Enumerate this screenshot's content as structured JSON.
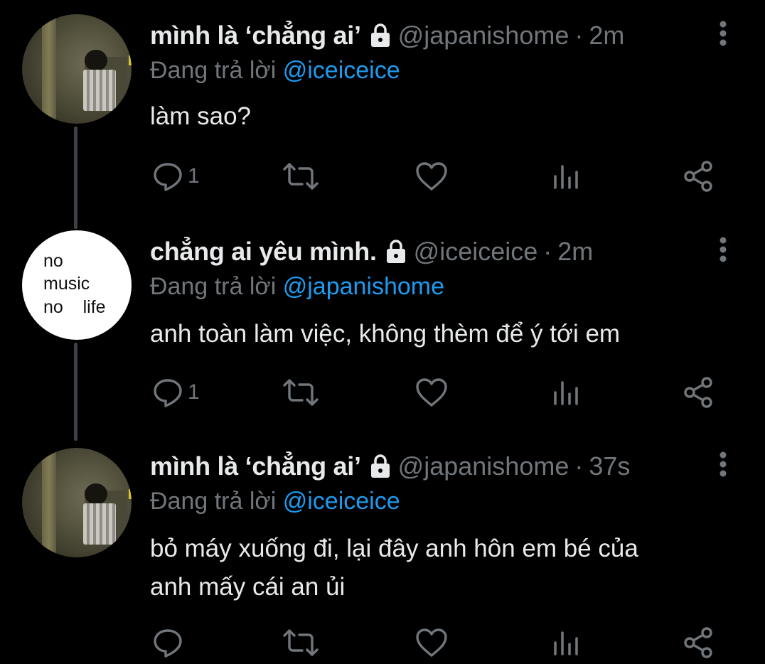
{
  "colors": {
    "background": "#000000",
    "primary_text": "#e7e9ea",
    "secondary_text": "#71767b",
    "accent": "#1d9bf0",
    "thread_line": "#3d4146"
  },
  "icons": {
    "lock": "lock-icon",
    "more": "more-vertical-icon",
    "reply": "reply-bubble-icon",
    "retweet": "retweet-icon",
    "like": "heart-icon",
    "views": "bar-chart-icon",
    "share": "share-icon"
  },
  "tweets": [
    {
      "display_name": "mình là ‘chẳng ai’",
      "handle": "@japanishome",
      "separator": "·",
      "time": "2m",
      "reply_prefix": "Đang trả lời",
      "reply_to": "@iceiceice",
      "text_lines": [
        "làm sao?"
      ],
      "reply_count": "1",
      "avatar_type": "photo"
    },
    {
      "display_name": "chẳng ai yêu mình.",
      "handle": "@iceiceice",
      "separator": "·",
      "time": "2m",
      "reply_prefix": "Đang trả lời",
      "reply_to": "@japanishome",
      "text_lines": [
        "anh toàn làm việc, không thèm để ý tới em"
      ],
      "reply_count": "1",
      "avatar_type": "text",
      "avatar_lines": [
        "no",
        "music",
        "no    life"
      ]
    },
    {
      "display_name": "mình là ‘chẳng ai’",
      "handle": "@japanishome",
      "separator": "·",
      "time": "37s",
      "reply_prefix": "Đang trả lời",
      "reply_to": "@iceiceice",
      "text_lines": [
        "bỏ máy xuống đi, lại đây anh hôn em bé của",
        "anh mấy cái an ủi"
      ],
      "reply_count": "",
      "avatar_type": "photo"
    }
  ]
}
